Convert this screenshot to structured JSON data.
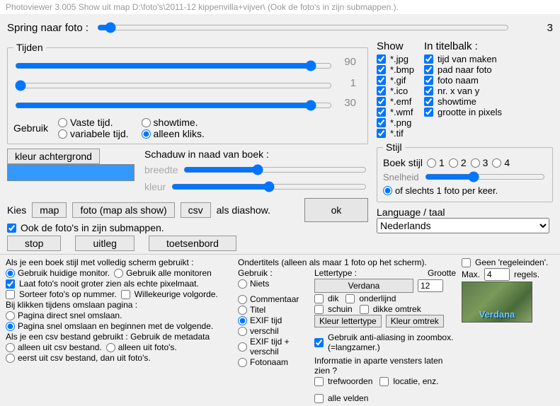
{
  "titlebar": "Photoviewer 3.005   Show uit map D:\\foto's\\2011-12 kippenvilla+vijver\\   (Ook de foto's in zijn submappen.).",
  "spring": {
    "label": "Spring naar foto :",
    "value": "3"
  },
  "tijden": {
    "legend": "Tijden",
    "v1": "90",
    "v2": "1",
    "v3": "30",
    "gebruik_label": "Gebruik",
    "opt_vaste": "Vaste tijd.",
    "opt_var": "variabele tijd.",
    "opt_show": "showtime.",
    "opt_klik": "alleen kliks."
  },
  "kleur_btn": "kleur achtergrond",
  "schaduw": {
    "title": "Schaduw in naad van boek :",
    "breedte": "breedte",
    "kleur": "kleur"
  },
  "kies": {
    "label": "Kies",
    "map": "map",
    "foto": "foto (map als show)",
    "csv": "csv",
    "als": "als diashow."
  },
  "submap_chk": "Ook de foto's in zijn submappen.",
  "btns": {
    "stop": "stop",
    "uitleg": "uitleg",
    "toets": "toetsenbord",
    "ok": "ok"
  },
  "show": {
    "head": "Show",
    "items": [
      "*.jpg",
      "*.bmp",
      "*.gif",
      "*.ico",
      "*.emf",
      "*.wmf",
      "*.png",
      "*.tif"
    ]
  },
  "titelbalk": {
    "head": "In titelbalk :",
    "items": [
      "tijd van maken",
      "pad naar foto",
      "foto naam",
      "nr. x van y",
      "showtime",
      "grootte in pixels"
    ]
  },
  "stijl": {
    "legend": "Stijl",
    "boek": "Boek stijl",
    "s1": "1",
    "s2": "2",
    "s3": "3",
    "s4": "4",
    "snelheid": "Snelheid",
    "slechts": "of slechts 1 foto per keer."
  },
  "lang": {
    "label": "Language / taal",
    "value": "Nederlands"
  },
  "bottom_left": {
    "l1": "Als je een boek stijl met volledig scherm gebruikt :",
    "r1a": "Gebruik huidige monitor.",
    "r1b": "Gebruik alle monitoren",
    "c2": "Laat foto's nooit groter zien als echte pixelmaat.",
    "c3a": "Sorteer foto's op nummer.",
    "c3b": "Willekeurige volgorde.",
    "l4": "Bij klikken tijdens omslaan pagina :",
    "r4a": "Pagina direct snel omslaan.",
    "r4b": "Pagina snel omslaan en beginnen met de volgende.",
    "l5": "Als je een csv bestand gebruikt : Gebruik de metadata",
    "r5a": "alleen uit csv bestand.",
    "r5b": "alleen uit foto's.",
    "r5c": "eerst uit csv bestand, dan uit foto's."
  },
  "mid": {
    "head": "Ondertitels (alleen als maar 1 foto op het scherm).",
    "gebruik": "Gebruik :",
    "niets": "Niets",
    "comm": "Commentaar",
    "titel": "Titel",
    "exif": "EXIF tijd",
    "versch": "verschil",
    "exifv": "EXIF tijd + verschil",
    "fname": "Fotonaam"
  },
  "font": {
    "lettertype": "Lettertype :",
    "verdana": "Verdana",
    "grootte_lbl": "Grootte",
    "grootte": "12",
    "dik": "dik",
    "onder": "onderlijnd",
    "schuin": "schuin",
    "dikom": "dikke omtrek",
    "btn1": "Kleur lettertype",
    "btn2": "Kleur omtrek",
    "thumb": "Verdana"
  },
  "right": {
    "geen": "Geen 'regeleinden'.",
    "max": "Max.",
    "regels": "regels.",
    "maxval": "4",
    "anti": "Gebruik anti-aliasing in zoombox. (=langzamer.)",
    "info": "Informatie in aparte vensters laten zien ?",
    "tref": "trefwoorden",
    "loc": "locatie, enz.",
    "alle": "alle velden"
  }
}
